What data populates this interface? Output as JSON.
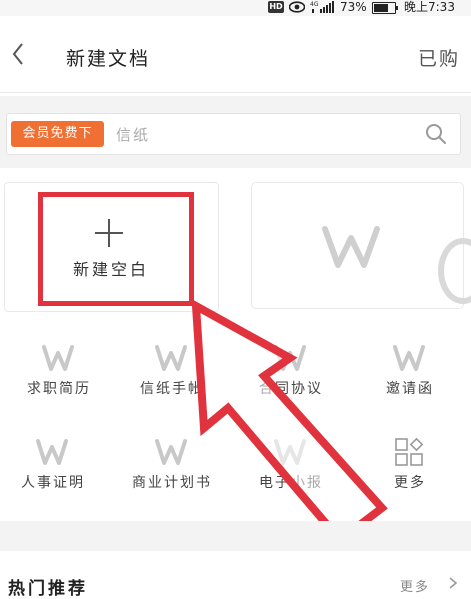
{
  "status_bar": {
    "hd": "HD",
    "signal_label": "4G",
    "battery": "73%",
    "time": "晚上7:33"
  },
  "header": {
    "title": "新建文档",
    "right": "已购"
  },
  "search": {
    "badge": "会员免费下",
    "placeholder": "信纸"
  },
  "blank_card": {
    "label": "新建空白"
  },
  "templates": [
    {
      "label": "求职简历",
      "icon": "wps-w-icon"
    },
    {
      "label": "信纸手帐",
      "icon": "wps-w-icon"
    },
    {
      "label": "合同协议",
      "icon": "wps-w-icon"
    },
    {
      "label": "邀请函",
      "icon": "wps-w-icon"
    },
    {
      "label": "人事证明",
      "icon": "wps-w-icon"
    },
    {
      "label": "商业计划书",
      "icon": "wps-w-icon"
    },
    {
      "label": "电子小报",
      "icon": "wps-w-icon"
    },
    {
      "label": "更多",
      "icon": "grid-more-icon"
    }
  ],
  "footer": {
    "title": "热门推荐",
    "more": "更多"
  },
  "colors": {
    "accent_orange": "#f07033",
    "annotation_red": "#e0333d",
    "icon_gray": "#c8c8c8"
  }
}
